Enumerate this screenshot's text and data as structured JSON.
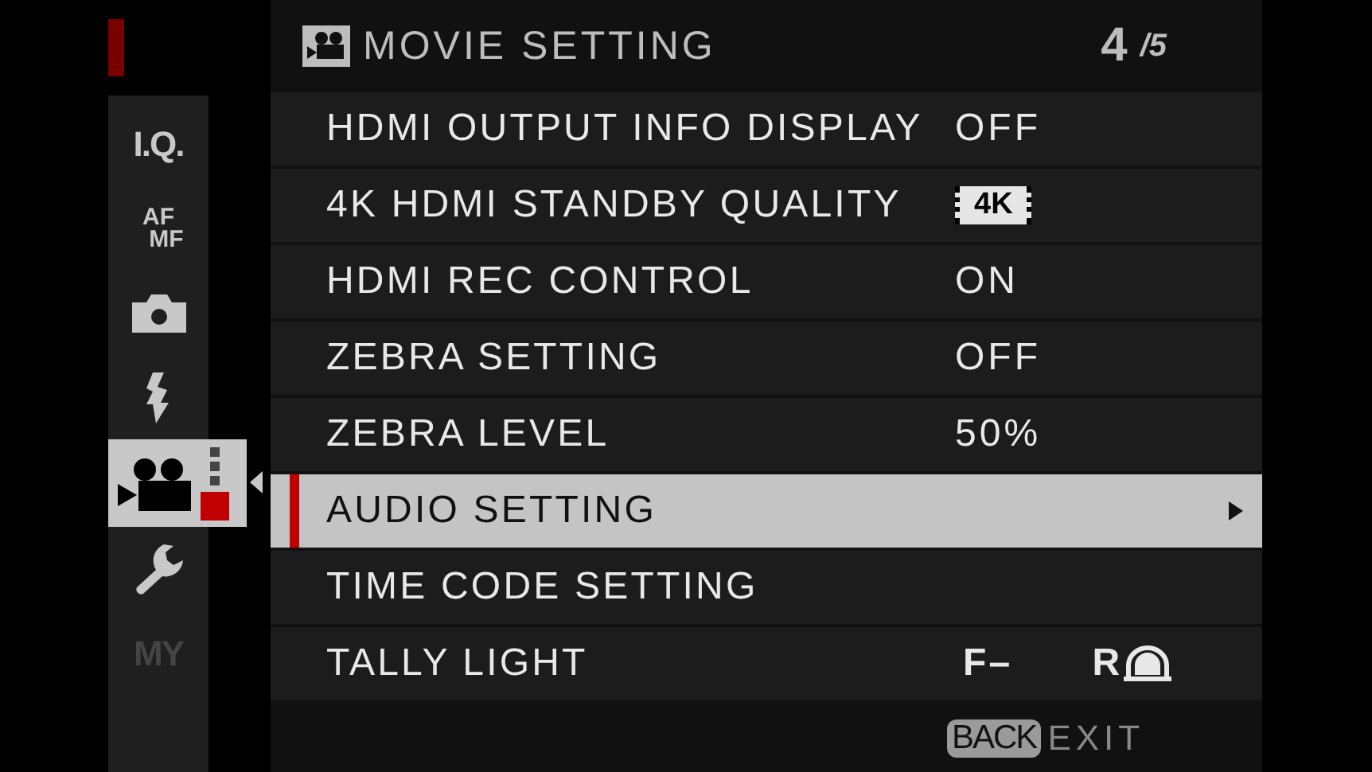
{
  "sidebar": {
    "items": [
      {
        "kind": "text",
        "label": "I.Q.",
        "selected": false,
        "disabled": false
      },
      {
        "kind": "stack",
        "label": "AF",
        "sublabel": "MF",
        "selected": false,
        "disabled": false
      },
      {
        "kind": "camera",
        "selected": false,
        "disabled": false
      },
      {
        "kind": "flash",
        "selected": false,
        "disabled": false
      },
      {
        "kind": "movie",
        "selected": true,
        "disabled": false
      },
      {
        "kind": "wrench",
        "selected": false,
        "disabled": false
      },
      {
        "kind": "text",
        "label": "MY",
        "selected": false,
        "disabled": true
      }
    ]
  },
  "header": {
    "title": "MOVIE SETTING",
    "page": "4",
    "page_total": "/5"
  },
  "rows": [
    {
      "label": "HDMI OUTPUT INFO DISPLAY",
      "kind": "text",
      "value": "OFF",
      "selected": false
    },
    {
      "label": "4K HDMI STANDBY QUALITY",
      "kind": "badge",
      "value": "4K",
      "selected": false
    },
    {
      "label": "HDMI REC CONTROL",
      "kind": "text",
      "value": "ON",
      "selected": false
    },
    {
      "label": "ZEBRA SETTING",
      "kind": "text",
      "value": "OFF",
      "selected": false
    },
    {
      "label": "ZEBRA LEVEL",
      "kind": "text",
      "value": "50%",
      "selected": false
    },
    {
      "label": "AUDIO SETTING",
      "kind": "submenu",
      "selected": true
    },
    {
      "label": "TIME CODE SETTING",
      "kind": "none",
      "selected": false
    },
    {
      "label": "TALLY LIGHT",
      "kind": "tally",
      "front": "F–",
      "rear": "R",
      "selected": false
    }
  ],
  "footer": {
    "key": "BACK",
    "action": "EXIT"
  }
}
